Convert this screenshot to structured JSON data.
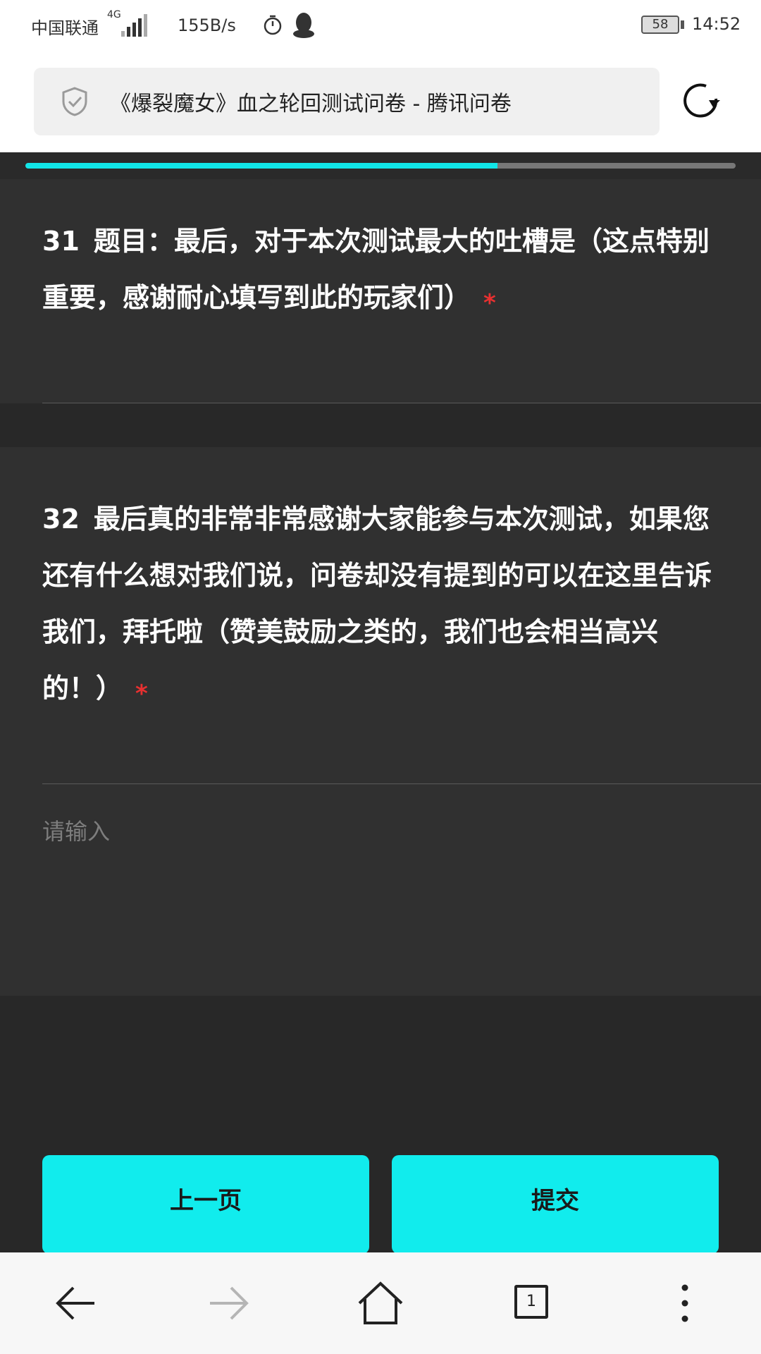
{
  "status_bar": {
    "carrier": "中国联通",
    "network_type": "4G",
    "net_speed": "155B/s",
    "battery": "58",
    "time": "14:52",
    "icons": [
      "signal-icon",
      "timer-icon",
      "qq-icon",
      "battery-icon"
    ]
  },
  "browser": {
    "page_title": "《爆裂魔女》血之轮回测试问卷 - 腾讯问卷",
    "icons": [
      "shield-icon",
      "reload-icon"
    ]
  },
  "progress": {
    "fraction": 0.665,
    "color": "#11e6e8"
  },
  "questions": [
    {
      "number": "31",
      "text": "题目：最后，对于本次测试最大的吐槽是（这点特别重要，感谢耐心填写到此的玩家们）",
      "required_mark": "*"
    },
    {
      "number": "32",
      "text": "最后真的非常非常感谢大家能参与本次测试，如果您还有什么想对我们说，问卷却没有提到的可以在这里告诉我们，拜托啦（赞美鼓励之类的，我们也会相当高兴的！）",
      "required_mark": "*",
      "input_placeholder": "请输入",
      "input_value": ""
    }
  ],
  "buttons": {
    "prev_label": "上一页",
    "submit_label": "提交",
    "color": "#11eced"
  },
  "bottom_nav": {
    "tab_count": "1",
    "icons": [
      "back-arrow-icon",
      "forward-arrow-icon",
      "home-icon",
      "tabs-icon",
      "more-menu-icon"
    ]
  }
}
